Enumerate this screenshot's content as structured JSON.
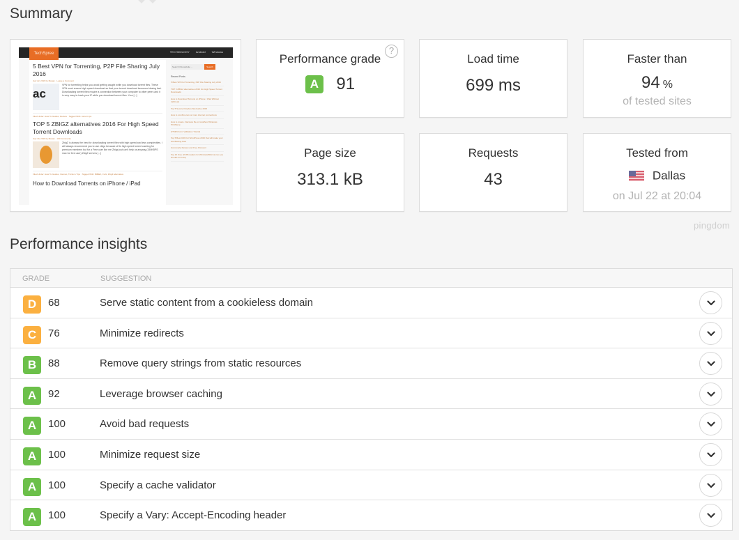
{
  "summary": {
    "title": "Summary",
    "thumbnail": {
      "site_logo": "TechSpree",
      "nav": [
        "TECHNOLOGY",
        "Android",
        "Windows"
      ],
      "posts": [
        {
          "title": "5 Best VPN for Torrenting, P2P File Sharing July 2016",
          "meta": "July 22, 2016 by Manav · Leave a Comment",
          "excerpt": "VPN for torrenting helps you avoid getting caught while you download torrent files. These VPN must ensure high speed download so that your torrent download becomes blazing fast. Downloading torrent files require a connection between your computer to other peers and it is very easy to track your IP while you download torrent files. Your [...]",
          "footer": "Filed Under: How To Guides, Review · Tagged With: torrent vpn",
          "image_text": "ac"
        },
        {
          "title": "TOP 5 ZBIGZ alternatives 2016 For High Speed Torrent Downloads",
          "meta": "July 19, 2016 by Manav · 100 Comments",
          "excerpt": "ZbigZ is always the best for downloading torrent files with high speed and less complexities. I will always recommend you to use zbigz because of its high speed torrent caching for premium members but for a Free user like me Zbigz just can't help us anyway (150KBPS max for free user) ZbigZ servers [...]",
          "footer": "Filed Under: How To Guides, Internet, Tricks & Tips · Tagged With: BitBEK, Furk, ZbigZ alternative"
        },
        {
          "title": "How to Download Torrents on iPhone / iPad"
        }
      ],
      "search_placeholder": "Search this website ...",
      "search_button": "Search",
      "recent_posts_label": "Recent Posts",
      "recent_posts": [
        "5 Best VPN for Torrenting, P2P File Sharing July 2016",
        "TOP 5 ZBIGZ alternatives 2016 For High Speed Torrent Downloads",
        "How to Download Torrents on iPhone / iPad Without Jailbreak",
        "Top 5 Secure Dropbox Alternative 2016",
        "How to combine two or more internet connections",
        "How to create .htaccess file on localhost Windows PC/Wamp",
        "HTML5 Form Validation Tutorial",
        "Top 5 Best CDN for WordPress 2016 that will make your site Blazing Fast",
        "Grammarly Review and Free Discount",
        "Top 10 Free ePUB readers for Windows/MAC (Linux you should not miss)"
      ]
    },
    "cards": {
      "performance_grade": {
        "label": "Performance grade",
        "grade": "A",
        "score": "91",
        "help": "?"
      },
      "load_time": {
        "label": "Load time",
        "value": "699 ms"
      },
      "faster_than": {
        "label": "Faster than",
        "value": "94",
        "unit": "%",
        "sub": "of tested sites"
      },
      "page_size": {
        "label": "Page size",
        "value": "313.1 kB"
      },
      "requests": {
        "label": "Requests",
        "value": "43"
      },
      "tested_from": {
        "label": "Tested from",
        "flag": "us-flag-icon",
        "city": "Dallas",
        "sub": "on Jul 22 at 20:04"
      }
    },
    "brand": "pingdom"
  },
  "insights": {
    "title": "Performance insights",
    "columns": {
      "grade": "Grade",
      "suggestion": "Suggestion"
    },
    "grade_colors": {
      "A": "#6cc04a",
      "B": "#6cc04a",
      "C": "#fbb040",
      "D": "#fbb040"
    },
    "rows": [
      {
        "grade": "D",
        "score": "68",
        "suggestion": "Serve static content from a cookieless domain"
      },
      {
        "grade": "C",
        "score": "76",
        "suggestion": "Minimize redirects"
      },
      {
        "grade": "B",
        "score": "88",
        "suggestion": "Remove query strings from static resources"
      },
      {
        "grade": "A",
        "score": "92",
        "suggestion": "Leverage browser caching"
      },
      {
        "grade": "A",
        "score": "100",
        "suggestion": "Avoid bad requests"
      },
      {
        "grade": "A",
        "score": "100",
        "suggestion": "Minimize request size"
      },
      {
        "grade": "A",
        "score": "100",
        "suggestion": "Specify a cache validator"
      },
      {
        "grade": "A",
        "score": "100",
        "suggestion": "Specify a Vary: Accept-Encoding header"
      }
    ]
  }
}
